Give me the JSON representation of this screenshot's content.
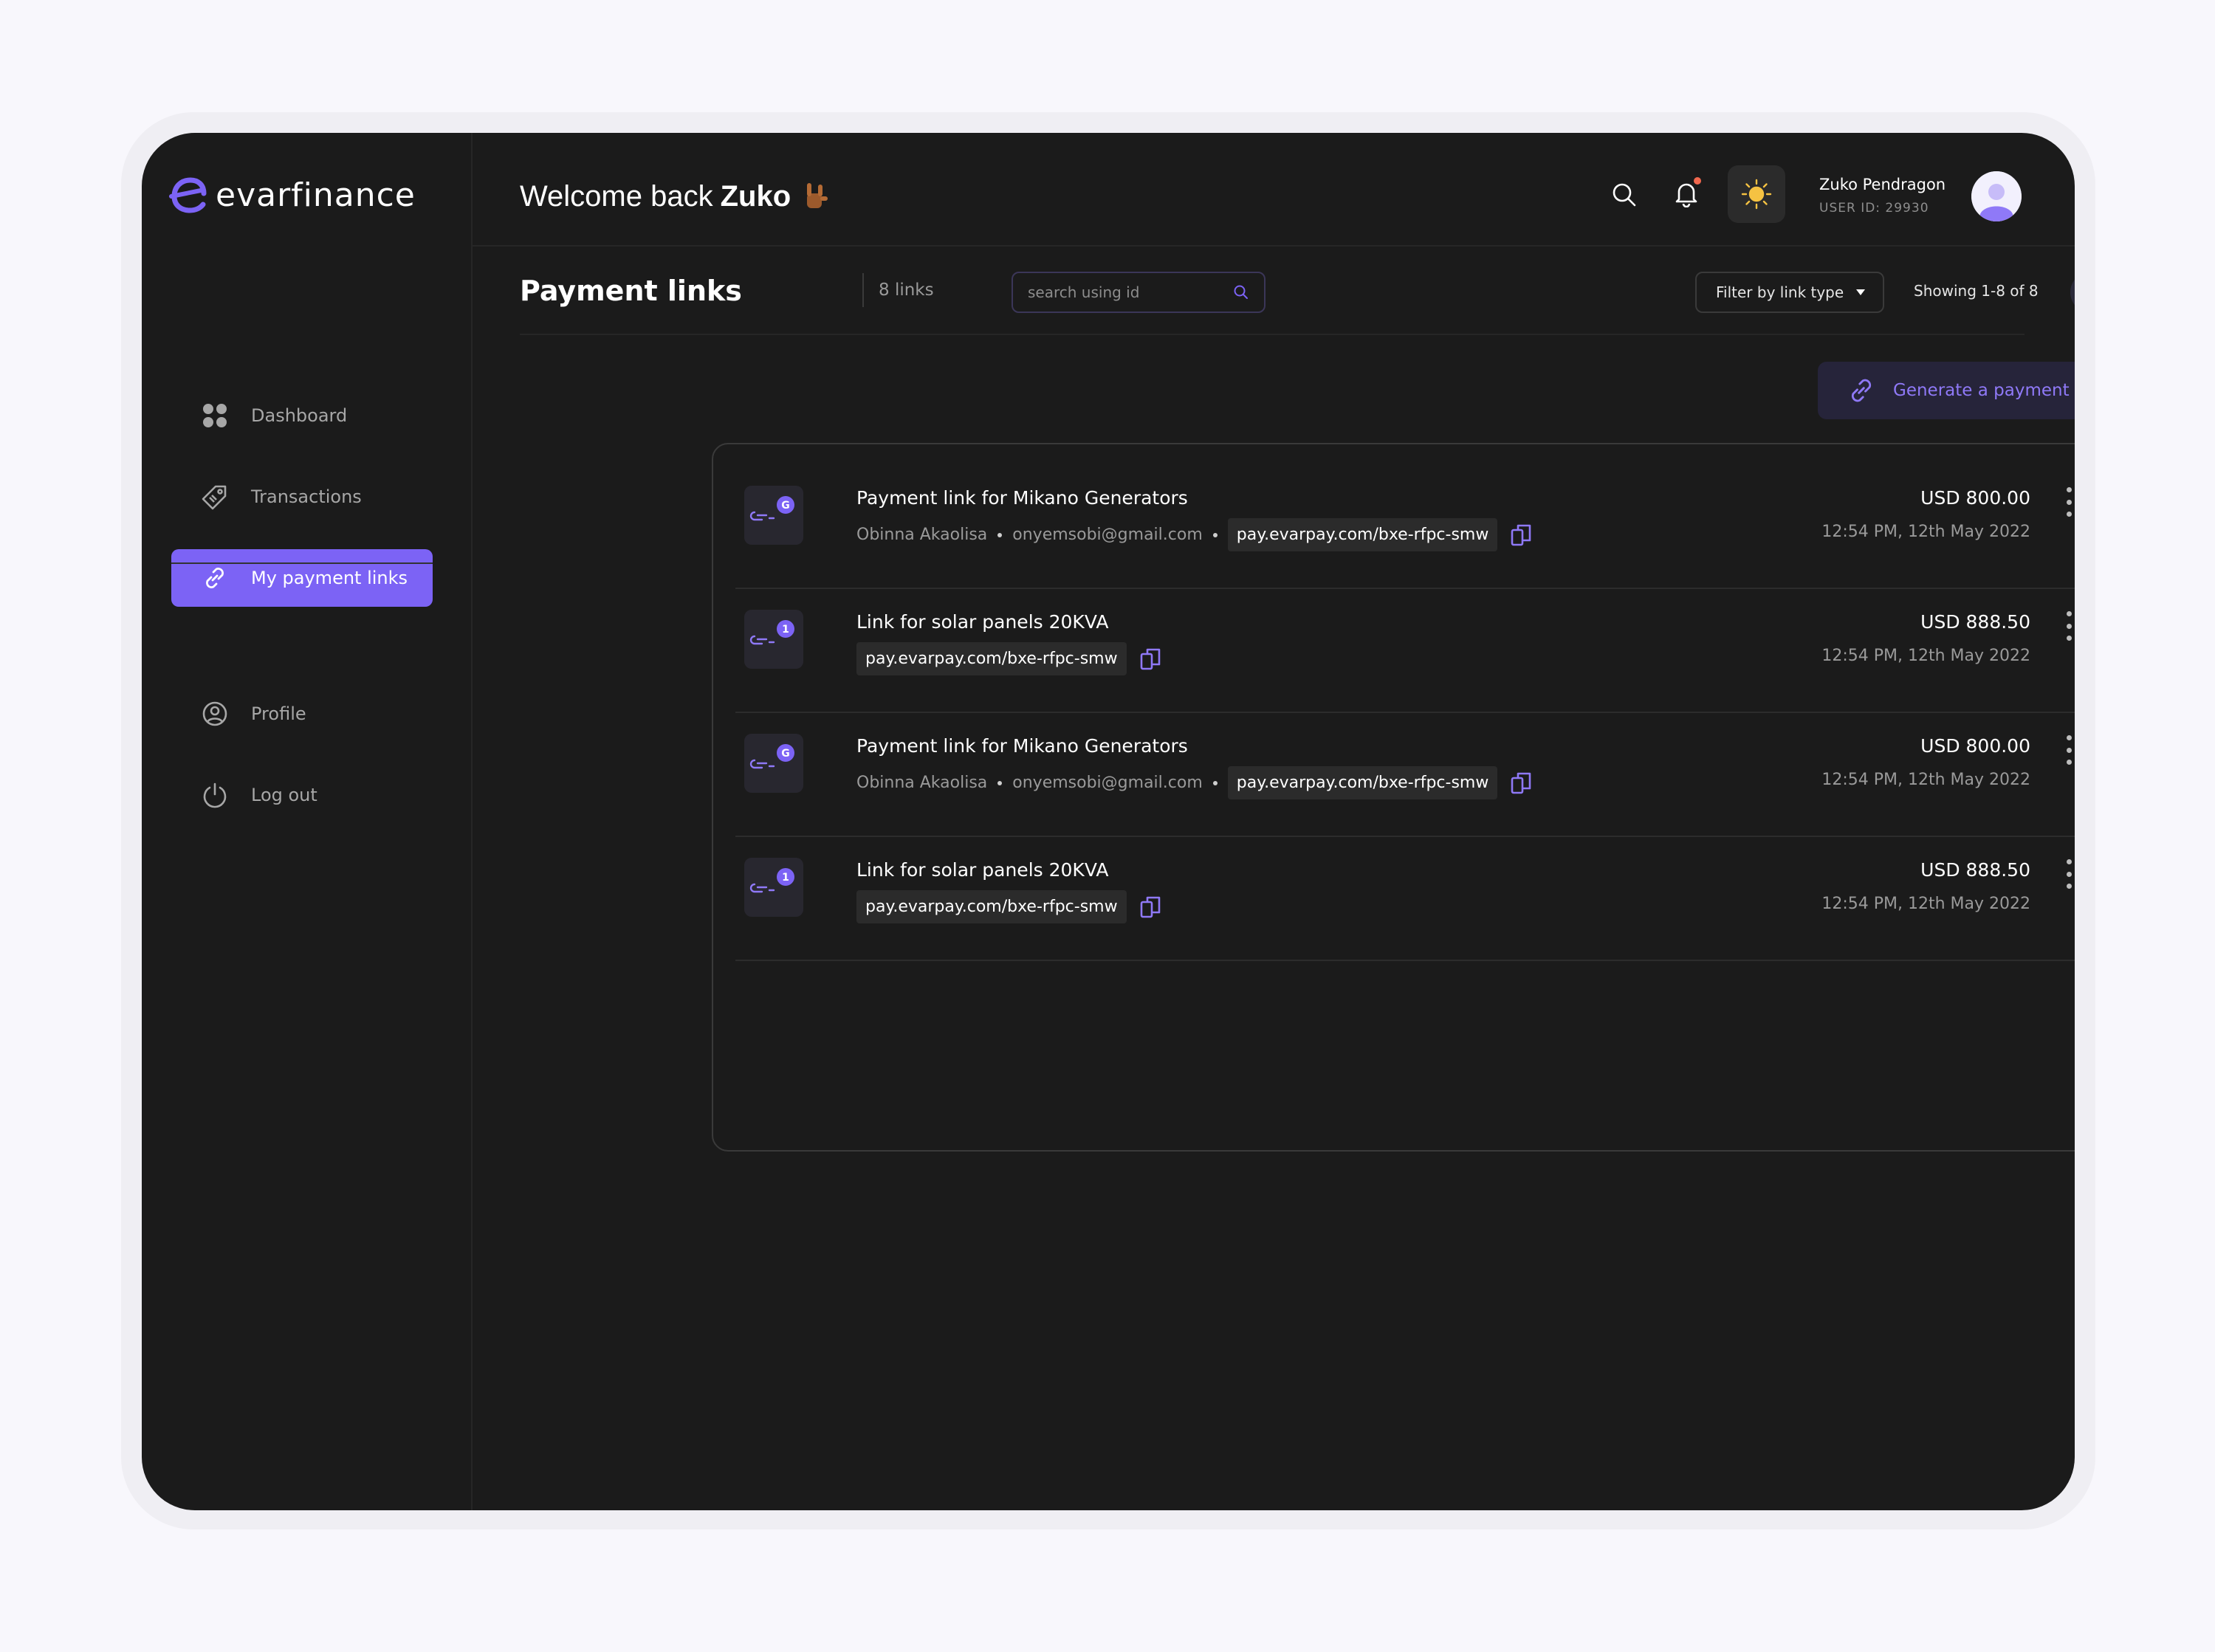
{
  "brand": {
    "name": "evarfinance",
    "accent": "#7c63f5"
  },
  "sidebar": {
    "items": [
      {
        "label": "Dashboard",
        "icon": "grid-icon"
      },
      {
        "label": "Transactions",
        "icon": "tag-icon"
      },
      {
        "label": "My payment links",
        "icon": "link-icon",
        "active": true
      },
      {
        "label": "Profile",
        "icon": "user-circle-icon"
      },
      {
        "label": "Log out",
        "icon": "power-icon"
      }
    ]
  },
  "header": {
    "welcome_prefix": "Welcome back",
    "welcome_name": "Zuko",
    "user_name": "Zuko Pendragon",
    "user_id": "USER ID: 29930"
  },
  "page": {
    "title": "Payment links",
    "count": "8 links",
    "search_placeholder": "search using id",
    "filter_label": "Filter by link type",
    "showing": "Showing 1-8 of 8",
    "generate_label": "Generate a payment link"
  },
  "links": [
    {
      "title": "Payment link for Mikano Generators",
      "name": "Obinna Akaolisa",
      "email": "onyemsobi@gmail.com",
      "url": "pay.evarpay.com/bxe-rfpc-smw",
      "amount": "USD 800.00",
      "date": "12:54 PM, 12th May 2022",
      "badge": "G"
    },
    {
      "title": "Link for solar panels 20KVA",
      "url": "pay.evarpay.com/bxe-rfpc-smw",
      "amount": "USD 888.50",
      "date": "12:54 PM, 12th May 2022",
      "badge": "1"
    },
    {
      "title": "Payment link for Mikano Generators",
      "name": "Obinna Akaolisa",
      "email": "onyemsobi@gmail.com",
      "url": "pay.evarpay.com/bxe-rfpc-smw",
      "amount": "USD 800.00",
      "date": "12:54 PM, 12th May 2022",
      "badge": "G"
    },
    {
      "title": "Link for solar panels 20KVA",
      "url": "pay.evarpay.com/bxe-rfpc-smw",
      "amount": "USD 888.50",
      "date": "12:54 PM, 12th May 2022",
      "badge": "1"
    }
  ]
}
